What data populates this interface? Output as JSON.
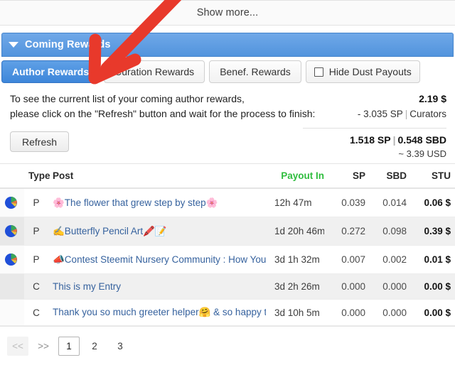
{
  "show_more": {
    "label": "Show more..."
  },
  "panel": {
    "title": "Coming Rewards",
    "caret_icon": "caret-down-icon"
  },
  "tabs": [
    {
      "label": "Author Rewards",
      "active": true
    },
    {
      "label": "Curation Rewards",
      "active": false
    },
    {
      "label": "Benef. Rewards",
      "active": false
    }
  ],
  "hide_dust": {
    "label": "Hide Dust Payouts",
    "checked": false,
    "icon": "checkbox-icon"
  },
  "info": {
    "line1": "To see the current list of your coming author rewards,",
    "line2": "please click on the \"Refresh\" button and wait for the process to finish:",
    "refresh_label": "Refresh"
  },
  "summary": {
    "total": "2.19 $",
    "sp_delta": "- 3.035 SP",
    "separator": "|",
    "curators_label": "Curators",
    "sp_value": "1.518 SP",
    "sbd_value": "0.548 SBD",
    "usd_value": "~ 3.39 USD"
  },
  "table": {
    "headers": {
      "icon": "",
      "type": "Type",
      "post": "Post",
      "payout": "Payout In",
      "sp": "SP",
      "sbd": "SBD",
      "stu": "STU"
    },
    "rows": [
      {
        "icon": "pie-chart-icon",
        "has_icon": true,
        "type": "P",
        "post": "🌸The flower that grew step by step🌸",
        "payout": "12h 47m",
        "sp": "0.039",
        "sbd": "0.014",
        "stu": "0.06 $"
      },
      {
        "icon": "pie-chart-icon",
        "has_icon": true,
        "type": "P",
        "post": "✍️Butterfly Pencil Art🖍️📝",
        "payout": "1d 20h 46m",
        "sp": "0.272",
        "sbd": "0.098",
        "stu": "0.39 $"
      },
      {
        "icon": "pie-chart-icon",
        "has_icon": true,
        "type": "P",
        "post": "📣Contest Steemit Nursery Community : How You Represent",
        "payout": "3d 1h 32m",
        "sp": "0.007",
        "sbd": "0.002",
        "stu": "0.01 $"
      },
      {
        "icon": "",
        "has_icon": false,
        "type": "C",
        "post": "This is my Entry",
        "payout": "3d 2h 26m",
        "sp": "0.000",
        "sbd": "0.000",
        "stu": "0.00 $"
      },
      {
        "icon": "",
        "has_icon": false,
        "type": "C",
        "post": "Thank you so much greeter helper🤗 & so happy to meet",
        "payout": "3d 10h 5m",
        "sp": "0.000",
        "sbd": "0.000",
        "stu": "0.00 $"
      }
    ]
  },
  "pagination": {
    "first_label": "<<",
    "next_label": ">>",
    "pages": [
      "1",
      "2",
      "3"
    ],
    "current": "1"
  },
  "annotation": {
    "arrow_icon": "red-arrow-annotation",
    "color": "#e8392b"
  },
  "colors": {
    "accent_blue": "#4a8edb",
    "payout_green": "#2fbd3e",
    "link_blue": "#36629e",
    "arrow_red": "#e8392b"
  }
}
